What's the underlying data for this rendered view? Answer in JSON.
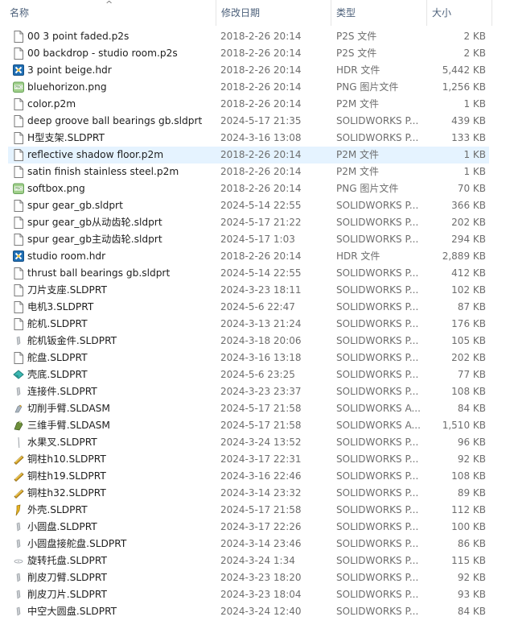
{
  "columns": {
    "name": "名称",
    "date": "修改日期",
    "type": "类型",
    "size": "大小"
  },
  "sort_indicator": "^",
  "files": [
    {
      "name": "00 3 point faded.p2s",
      "date": "2018-2-26 20:14",
      "type": "P2S 文件",
      "size": "2 KB",
      "icon": "document-icon"
    },
    {
      "name": "00 backdrop - studio room.p2s",
      "date": "2018-2-26 20:14",
      "type": "P2S 文件",
      "size": "2 KB",
      "icon": "document-icon"
    },
    {
      "name": "3 point beige.hdr",
      "date": "2018-2-26 20:14",
      "type": "HDR 文件",
      "size": "5,442 KB",
      "icon": "hdr-file-icon"
    },
    {
      "name": "bluehorizon.png",
      "date": "2018-2-26 20:14",
      "type": "PNG 图片文件",
      "size": "1,256 KB",
      "icon": "png-file-icon"
    },
    {
      "name": "color.p2m",
      "date": "2018-2-26 20:14",
      "type": "P2M 文件",
      "size": "1 KB",
      "icon": "document-icon"
    },
    {
      "name": "deep groove ball bearings gb.sldprt",
      "date": "2024-5-17 21:35",
      "type": "SOLIDWORKS P...",
      "size": "439 KB",
      "icon": "document-icon"
    },
    {
      "name": "H型支架.SLDPRT",
      "date": "2024-3-16 13:08",
      "type": "SOLIDWORKS P...",
      "size": "133 KB",
      "icon": "document-icon"
    },
    {
      "name": "reflective shadow floor.p2m",
      "date": "2018-2-26 20:14",
      "type": "P2M 文件",
      "size": "1 KB",
      "icon": "document-icon",
      "selected": true
    },
    {
      "name": "satin finish stainless steel.p2m",
      "date": "2018-2-26 20:14",
      "type": "P2M 文件",
      "size": "1 KB",
      "icon": "document-icon"
    },
    {
      "name": "softbox.png",
      "date": "2018-2-26 20:14",
      "type": "PNG 图片文件",
      "size": "70 KB",
      "icon": "png-file-icon"
    },
    {
      "name": "spur gear_gb.sldprt",
      "date": "2024-5-14 22:55",
      "type": "SOLIDWORKS P...",
      "size": "366 KB",
      "icon": "document-icon"
    },
    {
      "name": "spur gear_gb从动齿轮.sldprt",
      "date": "2024-5-17 21:22",
      "type": "SOLIDWORKS P...",
      "size": "202 KB",
      "icon": "document-icon"
    },
    {
      "name": "spur gear_gb主动齿轮.sldprt",
      "date": "2024-5-17 1:03",
      "type": "SOLIDWORKS P...",
      "size": "294 KB",
      "icon": "document-icon"
    },
    {
      "name": "studio room.hdr",
      "date": "2018-2-26 20:14",
      "type": "HDR 文件",
      "size": "2,889 KB",
      "icon": "hdr-file-icon"
    },
    {
      "name": "thrust ball bearings gb.sldprt",
      "date": "2024-5-14 22:55",
      "type": "SOLIDWORKS P...",
      "size": "412 KB",
      "icon": "document-icon"
    },
    {
      "name": "刀片支座.SLDPRT",
      "date": "2024-3-23 18:11",
      "type": "SOLIDWORKS P...",
      "size": "102 KB",
      "icon": "document-icon"
    },
    {
      "name": "电机3.SLDPRT",
      "date": "2024-5-6 22:47",
      "type": "SOLIDWORKS P...",
      "size": "87 KB",
      "icon": "document-icon"
    },
    {
      "name": "舵机.SLDPRT",
      "date": "2024-3-13 21:24",
      "type": "SOLIDWORKS P...",
      "size": "176 KB",
      "icon": "document-icon"
    },
    {
      "name": "舵机钣金件.SLDPRT",
      "date": "2024-3-18 20:06",
      "type": "SOLIDWORKS P...",
      "size": "105 KB",
      "icon": "part-thumbnail-icon"
    },
    {
      "name": "舵盘.SLDPRT",
      "date": "2024-3-16 13:18",
      "type": "SOLIDWORKS P...",
      "size": "202 KB",
      "icon": "document-icon"
    },
    {
      "name": "壳底.SLDPRT",
      "date": "2024-5-6 23:25",
      "type": "SOLIDWORKS P...",
      "size": "77 KB",
      "icon": "shell-thumbnail-icon"
    },
    {
      "name": "连接件.SLDPRT",
      "date": "2024-3-23 23:37",
      "type": "SOLIDWORKS P...",
      "size": "108 KB",
      "icon": "part-thumbnail-icon"
    },
    {
      "name": "切削手臂.SLDASM",
      "date": "2024-5-17 21:58",
      "type": "SOLIDWORKS A...",
      "size": "84 KB",
      "icon": "assembly-thumbnail-icon"
    },
    {
      "name": "三维手臂.SLDASM",
      "date": "2024-5-17 21:58",
      "type": "SOLIDWORKS A...",
      "size": "1,510 KB",
      "icon": "arm-thumbnail-icon"
    },
    {
      "name": "水果叉.SLDPRT",
      "date": "2024-3-24 13:52",
      "type": "SOLIDWORKS P...",
      "size": "96 KB",
      "icon": "fork-thumbnail-icon"
    },
    {
      "name": "铜柱h10.SLDPRT",
      "date": "2024-3-17 22:31",
      "type": "SOLIDWORKS P...",
      "size": "92 KB",
      "icon": "copper-pillar-icon"
    },
    {
      "name": "铜柱h19.SLDPRT",
      "date": "2024-3-16 22:46",
      "type": "SOLIDWORKS P...",
      "size": "108 KB",
      "icon": "copper-pillar-icon"
    },
    {
      "name": "铜柱h32.SLDPRT",
      "date": "2024-3-14 23:32",
      "type": "SOLIDWORKS P...",
      "size": "89 KB",
      "icon": "copper-pillar-icon"
    },
    {
      "name": "外壳.SLDPRT",
      "date": "2024-5-17 21:58",
      "type": "SOLIDWORKS P...",
      "size": "112 KB",
      "icon": "housing-thumbnail-icon"
    },
    {
      "name": "小圆盘.SLDPRT",
      "date": "2024-3-17 22:26",
      "type": "SOLIDWORKS P...",
      "size": "100 KB",
      "icon": "part-thumbnail-icon"
    },
    {
      "name": "小圆盘接舵盘.SLDPRT",
      "date": "2024-3-14 23:46",
      "type": "SOLIDWORKS P...",
      "size": "86 KB",
      "icon": "part-thumbnail-icon"
    },
    {
      "name": "旋转托盘.SLDPRT",
      "date": "2024-3-24 1:34",
      "type": "SOLIDWORKS P...",
      "size": "115 KB",
      "icon": "tray-thumbnail-icon"
    },
    {
      "name": "削皮刀臂.SLDPRT",
      "date": "2024-3-23 18:20",
      "type": "SOLIDWORKS P...",
      "size": "92 KB",
      "icon": "part-thumbnail-icon"
    },
    {
      "name": "削皮刀片.SLDPRT",
      "date": "2024-3-23 18:04",
      "type": "SOLIDWORKS P...",
      "size": "93 KB",
      "icon": "part-thumbnail-icon"
    },
    {
      "name": "中空大圆盘.SLDPRT",
      "date": "2024-3-24 12:40",
      "type": "SOLIDWORKS P...",
      "size": "84 KB",
      "icon": "part-thumbnail-icon"
    }
  ]
}
